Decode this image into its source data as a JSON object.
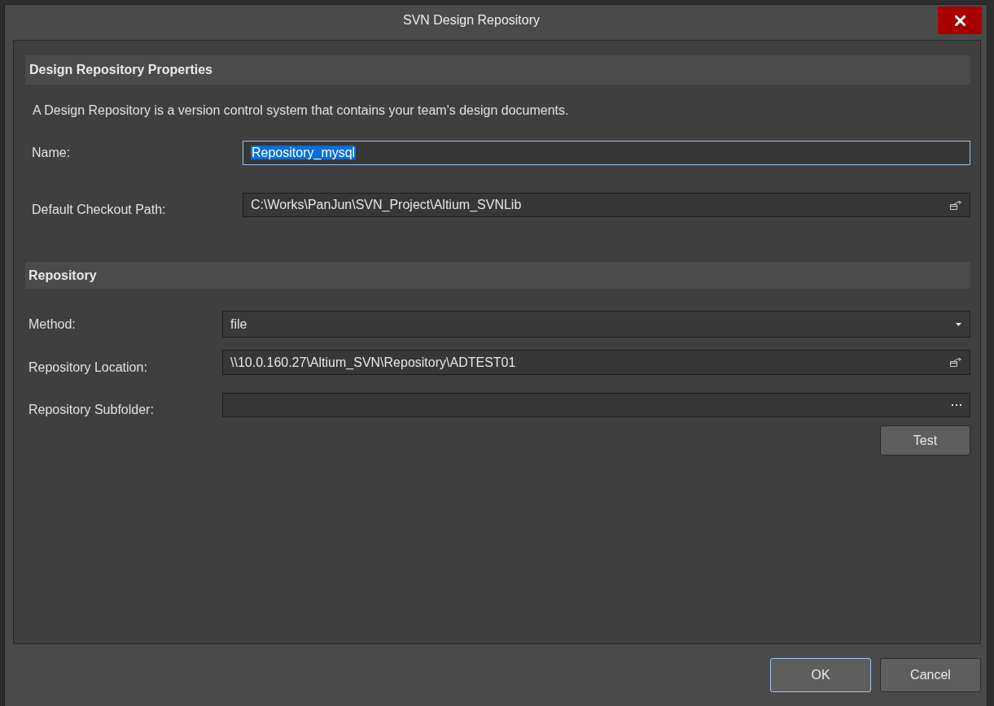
{
  "window": {
    "title": "SVN Design Repository"
  },
  "sections": [
    {
      "title": "Design Repository Properties",
      "description": "A Design Repository is a version control system that contains your team's design documents.",
      "fields": [
        {
          "label": "Name:",
          "kind": "text",
          "value": "Repository_mysql",
          "focused": true
        },
        {
          "label": "Default Checkout Path:",
          "kind": "browse",
          "value": "C:\\Works\\PanJun\\SVN_Project\\Altium_SVNLib",
          "focused": false
        }
      ]
    },
    {
      "title": "Repository",
      "fields": [
        {
          "label": "Method:",
          "kind": "dropdown",
          "value": "file",
          "focused": false
        },
        {
          "label": "Repository Location:",
          "kind": "browse",
          "value": "\\\\10.0.160.27\\Altium_SVN\\Repository\\ADTEST01",
          "focused": false
        },
        {
          "label": "Repository Subfolder:",
          "kind": "ellipsis",
          "focused": false
        }
      ],
      "buttons": [
        "Test"
      ]
    }
  ],
  "footer_buttons": [
    {
      "label": "OK",
      "default": true
    },
    {
      "label": "Cancel",
      "default": false
    }
  ]
}
